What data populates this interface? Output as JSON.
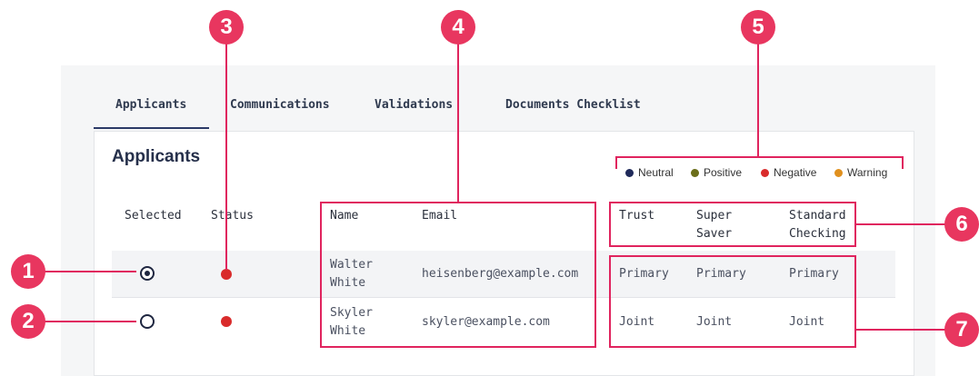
{
  "tabs": [
    {
      "label": "Applicants",
      "active": true
    },
    {
      "label": "Communications",
      "active": false
    },
    {
      "label": "Validations",
      "active": false
    },
    {
      "label": "Documents Checklist",
      "active": false
    }
  ],
  "card_title": "Applicants",
  "legend": [
    {
      "label": "Neutral",
      "color": "#1f2a5a"
    },
    {
      "label": "Positive",
      "color": "#6b6e1a"
    },
    {
      "label": "Negative",
      "color": "#d92b2b"
    },
    {
      "label": "Warning",
      "color": "#e0901e"
    }
  ],
  "columns": {
    "selected": "Selected",
    "status": "Status",
    "name": "Name",
    "email": "Email",
    "trust": "Trust",
    "super_saver_1": "Super",
    "super_saver_2": "Saver",
    "standard_checking_1": "Standard",
    "standard_checking_2": "Checking"
  },
  "rows": [
    {
      "selected": true,
      "status_color": "#d92b2b",
      "first": "Walter",
      "last": "White",
      "email": "heisenberg@example.com",
      "trust": "Primary",
      "super_saver": "Primary",
      "standard_checking": "Primary"
    },
    {
      "selected": false,
      "status_color": "#d92b2b",
      "first": "Skyler",
      "last": "White",
      "email": "skyler@example.com",
      "trust": "Joint",
      "super_saver": "Joint",
      "standard_checking": "Joint"
    }
  ],
  "callouts": [
    "1",
    "2",
    "3",
    "4",
    "5",
    "6",
    "7"
  ],
  "accent_color": "#e0245e"
}
